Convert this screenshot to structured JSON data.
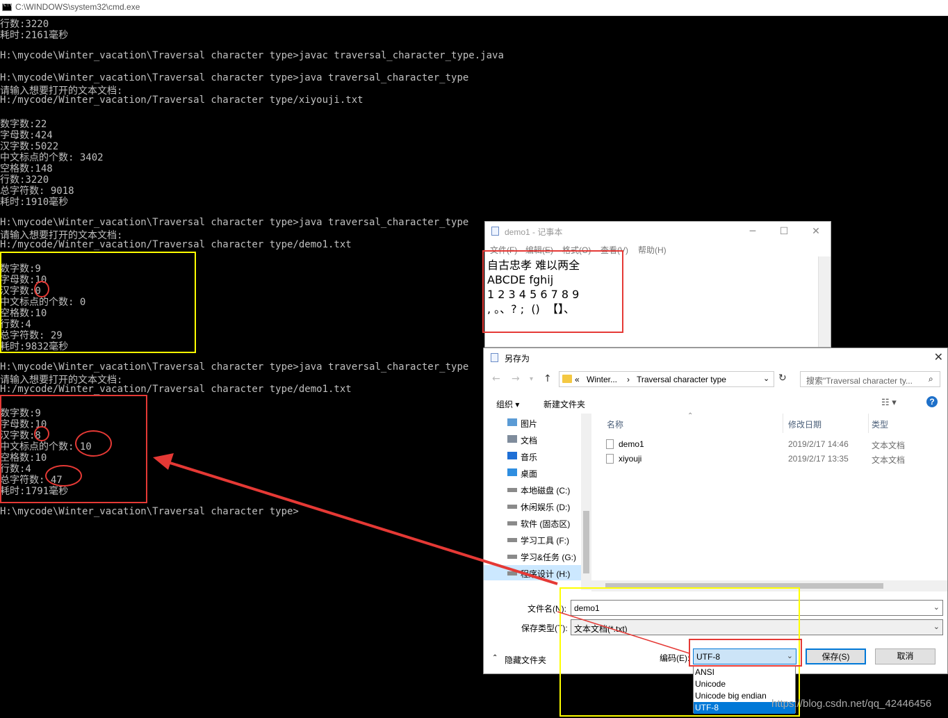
{
  "cmd": {
    "title": "C:\\WINDOWS\\system32\\cmd.exe",
    "lines": [
      "行数:3220",
      "耗时:2161毫秒",
      "",
      "H:\\mycode\\Winter_vacation\\Traversal character type>javac traversal_character_type.java",
      "",
      "H:\\mycode\\Winter_vacation\\Traversal character type>java traversal_character_type",
      "请输入想要打开的文本文档:",
      "H:/mycode/Winter_vacation/Traversal character type/xiyouji.txt",
      "",
      "数字数:22",
      "字母数:424",
      "汉字数:5022",
      "中文标点的个数: 3402",
      "空格数:148",
      "行数:3220",
      "总字符数: 9018",
      "耗时:1910毫秒",
      "",
      "H:\\mycode\\Winter_vacation\\Traversal character type>java traversal_character_type",
      "请输入想要打开的文本文档:",
      "H:/mycode/Winter_vacation/Traversal character type/demo1.txt",
      "",
      "数字数:9",
      "字母数:10",
      "汉字数:0",
      "中文标点的个数: 0",
      "空格数:10",
      "行数:4",
      "总字符数: 29",
      "耗时:9832毫秒",
      "",
      "H:\\mycode\\Winter_vacation\\Traversal character type>java traversal_character_type",
      "请输入想要打开的文本文档:",
      "H:/mycode/Winter_vacation/Traversal character type/demo1.txt",
      "",
      "数字数:9",
      "字母数:10",
      "汉字数:8",
      "中文标点的个数: 10",
      "空格数:10",
      "行数:4",
      "总字符数: 47",
      "耗时:1791毫秒",
      "",
      "H:\\mycode\\Winter_vacation\\Traversal character type>"
    ]
  },
  "notepad": {
    "title": "demo1 - 记事本",
    "menu": [
      "文件(F)",
      "编辑(E)",
      "格式(O)",
      "查看(V)",
      "帮助(H)"
    ],
    "content": [
      "自古忠孝 难以两全",
      "ABCDE fghij",
      "1 2 3 4 5 6 7 8 9",
      ", 。、? ;  ()  【】、"
    ]
  },
  "dialog": {
    "title": "另存为",
    "breadcrumb": [
      "«",
      "Winter...",
      "›",
      "Traversal character type"
    ],
    "search_placeholder": "搜索\"Traversal character ty...",
    "organize": "组织 ▾",
    "new_folder": "新建文件夹",
    "help": "?",
    "tree": [
      {
        "label": "图片",
        "icon": "pictures-icon"
      },
      {
        "label": "文档",
        "icon": "documents-icon"
      },
      {
        "label": "音乐",
        "icon": "music-icon"
      },
      {
        "label": "桌面",
        "icon": "desktop-icon"
      },
      {
        "label": "本地磁盘 (C:)",
        "icon": "drive-icon"
      },
      {
        "label": "休闲娱乐 (D:)",
        "icon": "drive-icon"
      },
      {
        "label": "软件 (固态区)",
        "icon": "drive-icon"
      },
      {
        "label": "学习工具 (F:)",
        "icon": "drive-icon"
      },
      {
        "label": "学习&任务 (G:)",
        "icon": "drive-icon"
      },
      {
        "label": "程序设计 (H:)",
        "icon": "drive-icon"
      }
    ],
    "columns": [
      "名称",
      "修改日期",
      "类型"
    ],
    "files": [
      {
        "name": "demo1",
        "date": "2019/2/17 14:46",
        "type": "文本文档"
      },
      {
        "name": "xiyouji",
        "date": "2019/2/17 13:35",
        "type": "文本文档"
      }
    ],
    "filename_label": "文件名(N):",
    "filename": "demo1",
    "filetype_label": "保存类型(T):",
    "filetype": "文本文档(*.txt)",
    "hide_folders": "隐藏文件夹",
    "encoding_label": "编码(E):",
    "encoding": "UTF-8",
    "save": "保存(S)",
    "cancel": "取消",
    "encoding_options": [
      "ANSI",
      "Unicode",
      "Unicode big endian",
      "UTF-8"
    ]
  },
  "watermark": "https://blog.csdn.net/qq_42446456",
  "colors": {
    "highlight_yellow": "#ffff00",
    "highlight_red": "#e53935",
    "console_text": "#c0c0c0",
    "selection_blue": "#0078d7"
  }
}
